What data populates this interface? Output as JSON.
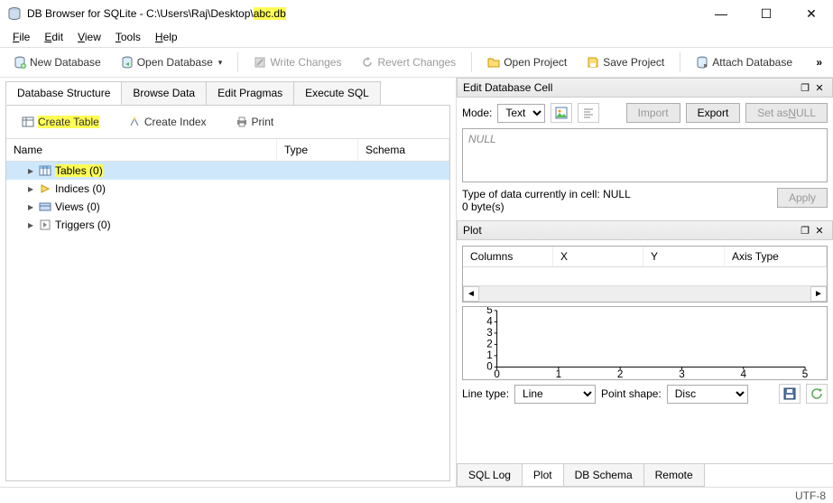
{
  "title": {
    "prefix": "DB Browser for SQLite - C:\\Users\\Raj\\Desktop\\",
    "file": "abc.db"
  },
  "menubar": [
    "File",
    "Edit",
    "View",
    "Tools",
    "Help"
  ],
  "toolbar": {
    "new_db": "New Database",
    "open_db": "Open Database",
    "write_changes": "Write Changes",
    "revert_changes": "Revert Changes",
    "open_project": "Open Project",
    "save_project": "Save Project",
    "attach_db": "Attach Database",
    "overflow": "»"
  },
  "main_tabs": [
    "Database Structure",
    "Browse Data",
    "Edit Pragmas",
    "Execute SQL"
  ],
  "sub_toolbar": {
    "create_table": "Create Table",
    "create_index": "Create Index",
    "print": "Print"
  },
  "tree_headers": {
    "name": "Name",
    "type": "Type",
    "schema": "Schema"
  },
  "tree_rows": [
    {
      "label": "Tables (0)",
      "icon": "table-icon",
      "selected": true,
      "highlight": true
    },
    {
      "label": "Indices (0)",
      "icon": "index-icon",
      "selected": false,
      "highlight": false
    },
    {
      "label": "Views (0)",
      "icon": "view-icon",
      "selected": false,
      "highlight": false
    },
    {
      "label": "Triggers (0)",
      "icon": "trigger-icon",
      "selected": false,
      "highlight": false
    }
  ],
  "edit_cell": {
    "title": "Edit Database Cell",
    "mode_label": "Mode:",
    "mode_value": "Text",
    "import": "Import",
    "export": "Export",
    "set_null": "Set as NULL",
    "cell_content": "NULL",
    "type_info": "Type of data currently in cell: NULL",
    "size_info": "0 byte(s)",
    "apply": "Apply"
  },
  "plot_panel": {
    "title": "Plot",
    "headers": {
      "columns": "Columns",
      "x": "X",
      "y": "Y",
      "axis_type": "Axis Type"
    },
    "line_type_label": "Line type:",
    "line_type_value": "Line",
    "point_shape_label": "Point shape:",
    "point_shape_value": "Disc"
  },
  "chart_data": {
    "type": "line",
    "x": [
      0,
      1,
      2,
      3,
      4,
      5
    ],
    "y_ticks": [
      0,
      1,
      2,
      3,
      4,
      5
    ],
    "xlim": [
      0,
      5
    ],
    "ylim": [
      0,
      5
    ],
    "series": []
  },
  "bottom_tabs": [
    "SQL Log",
    "Plot",
    "DB Schema",
    "Remote"
  ],
  "statusbar": {
    "encoding": "UTF-8"
  }
}
